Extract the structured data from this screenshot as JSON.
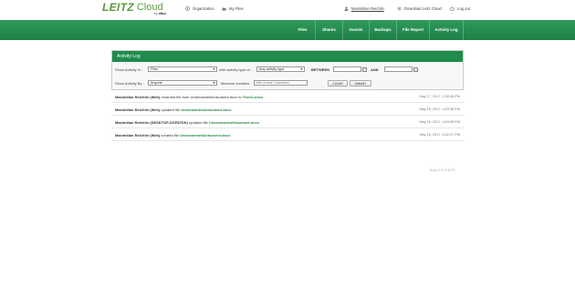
{
  "header": {
    "logo_brand": "LEITZ",
    "logo_product": "Cloud",
    "logo_by_prefix": "by",
    "logo_by_name": "xBox",
    "nav": [
      {
        "label": "Organization",
        "icon": "organization-icon"
      },
      {
        "label": "My Files",
        "icon": "folder-icon"
      },
      {
        "label": "Maximilian Reichlin",
        "icon": "user-icon"
      },
      {
        "label": "Download Leitz Cloud",
        "icon": "gear-icon"
      },
      {
        "label": "Log out",
        "icon": "logout-icon"
      }
    ]
  },
  "menu": [
    "Files",
    "Shares",
    "Guests",
    "Backups",
    "File Report",
    "Activity Log"
  ],
  "panel": {
    "title": "Activity Log",
    "show_activity_in_label": "Show Activity In :",
    "show_activity_in_value": "Files",
    "activity_type_label": "with activity type of :",
    "activity_type_value": "Any activity type",
    "between_label": "BETWEEN",
    "and_label": "AND",
    "show_activity_by_label": "Show Activity By :",
    "show_activity_by_value": "Anyone",
    "filename_label": "filename contains",
    "filename_placeholder": "enter at least 4 characters",
    "clear_label": "CLEAR",
    "submit_label": "SUBMIT"
  },
  "activities": [
    {
      "user": "Maximilian Reichlin (Web)",
      "action": " renamed file from UnbenanntesDokument.docx to ",
      "file": "Test11.docx",
      "time": "May 17, 2017, 1:00:36 PM"
    },
    {
      "user": "Maximilian Reichlin (Web)",
      "action": " updated file ",
      "file": "UnbenanntesDokument.docx",
      "time": "May 16, 2017, 4:03:36 PM"
    },
    {
      "user": "Maximilian Reichlin (DESKTOP-DSP87DK)",
      "action": " updated file ",
      "file": "UnbenanntesDokument.docx",
      "time": "May 16, 2017, 4:03:08 PM"
    },
    {
      "user": "Maximilian Reichlin (Web)",
      "action": " created file ",
      "file": "UnbenanntesDokument.docx",
      "time": "May 16, 2017, 4:02:27 PM"
    }
  ],
  "build": "Build 2.5.4.1075"
}
